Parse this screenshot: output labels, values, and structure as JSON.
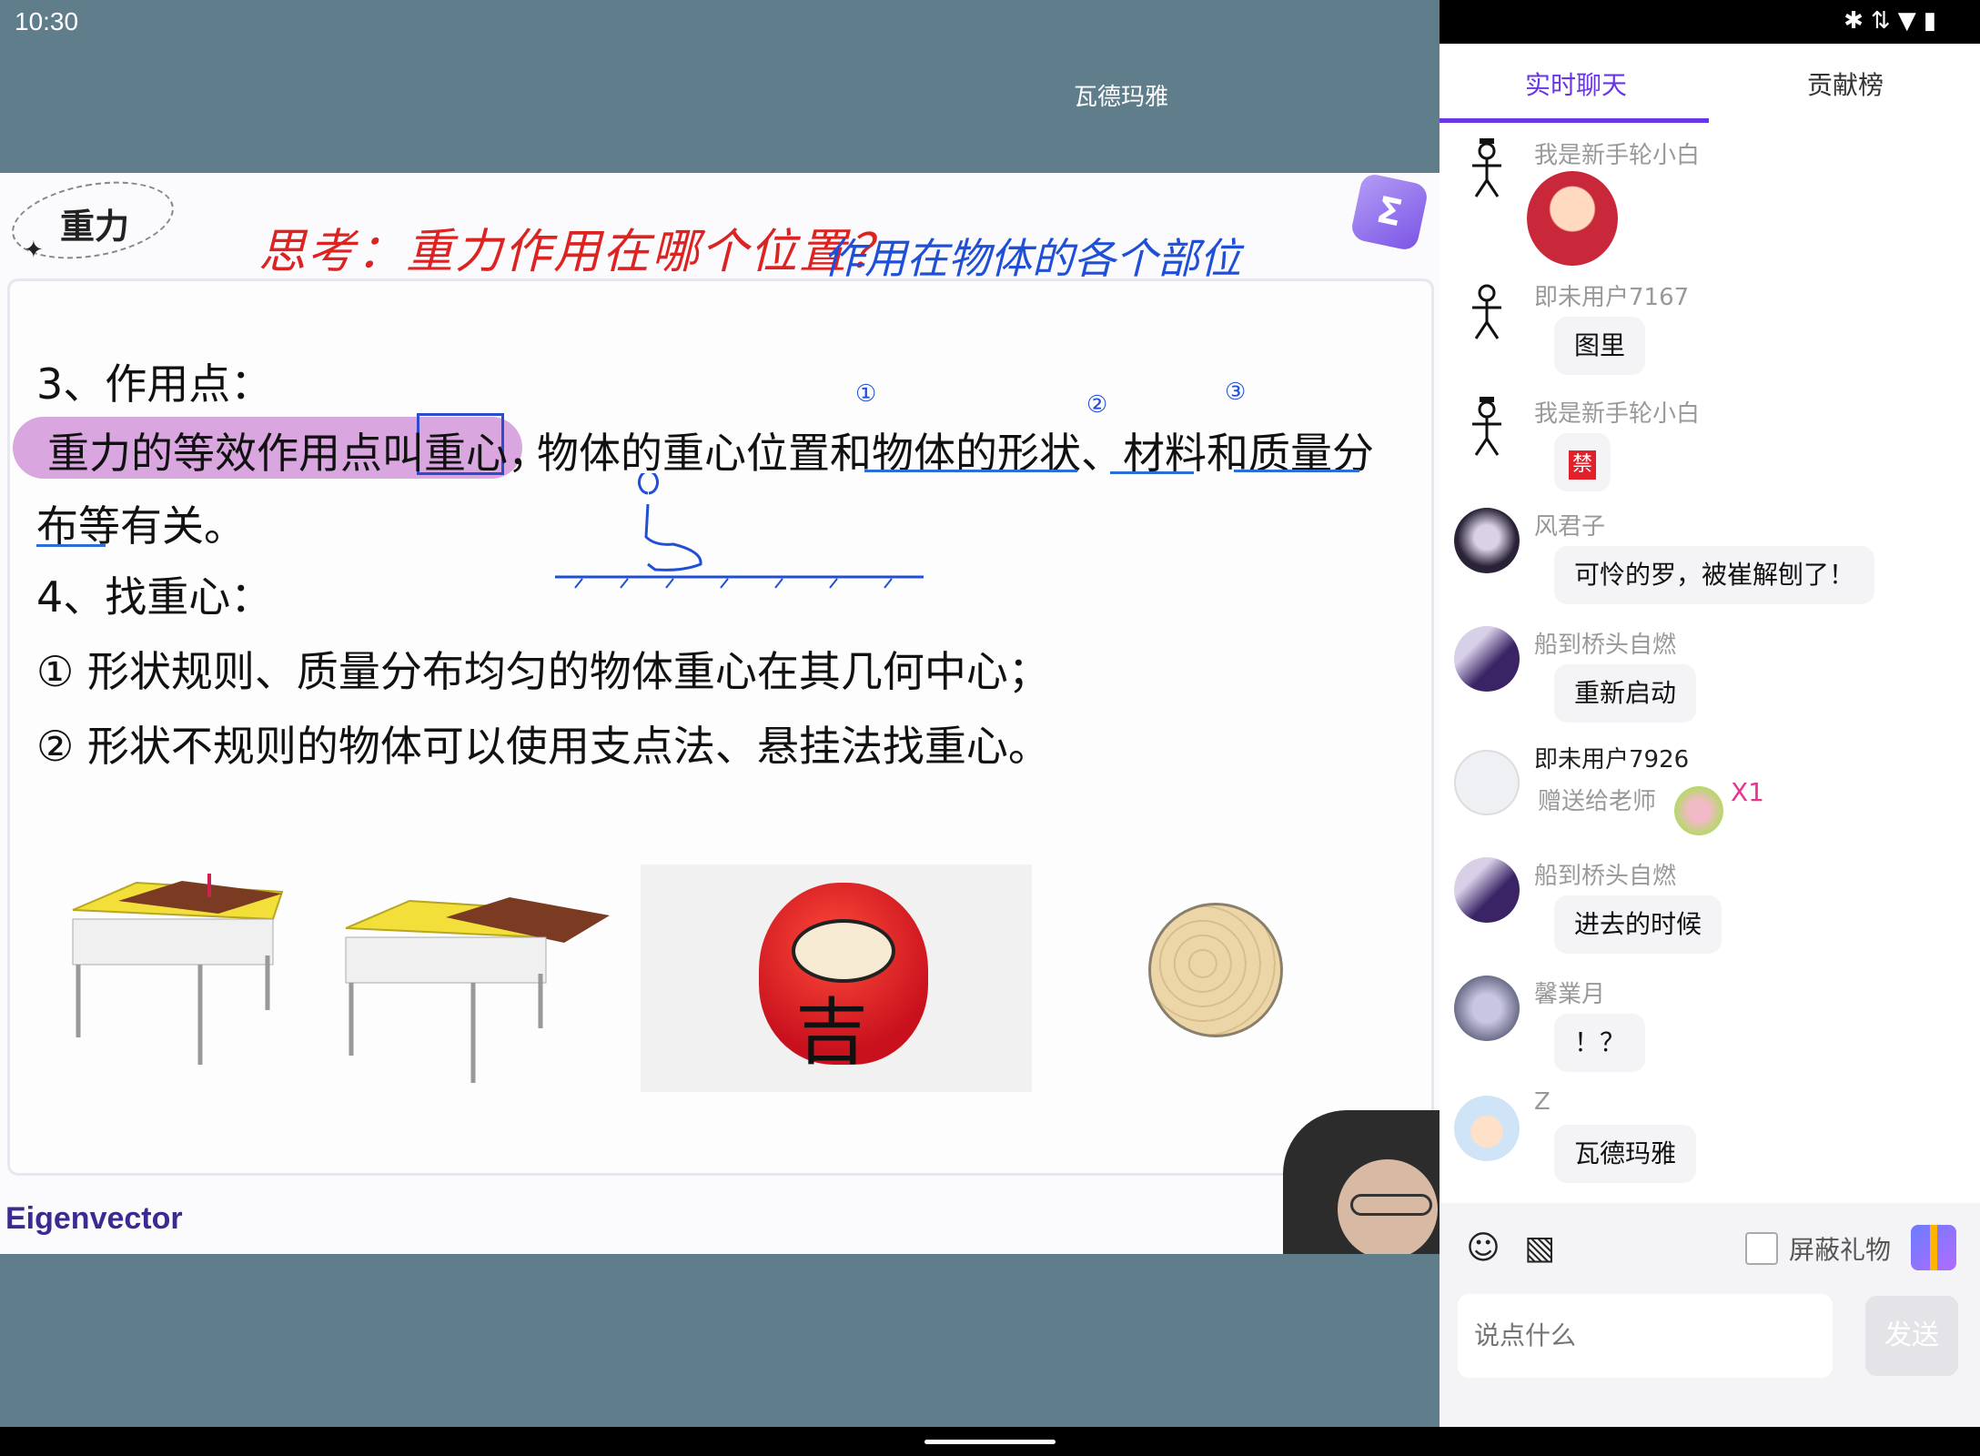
{
  "status_bar": {
    "time": "10:30",
    "icons": [
      "bluetooth-icon",
      "signal-icon",
      "wifi-icon",
      "battery-icon"
    ]
  },
  "room": {
    "title": "瓦德玛雅"
  },
  "slide": {
    "tag": "重力",
    "handwriting_red": "思考：重力作用在哪个位置？",
    "handwriting_blue": "作用在物体的各个部位",
    "point3_title": "3、作用点：",
    "point3_line1_highlight": "重力的等效作用点叫重心，",
    "point3_line1_rest": "物体的重心位置和物体的形状、材料和质量分",
    "point3_line2": "布等有关。",
    "point4_title": "4、找重心：",
    "point4_item1": "① 形状规则、质量分布均匀的物体重心在其几何中心；",
    "point4_item2": "② 形状不规则的物体可以使用支点法、悬挂法找重心。",
    "daruma_char": "吉",
    "annotations": [
      "①",
      "②",
      "③"
    ],
    "logo_text": "Eigenvector"
  },
  "chat": {
    "tabs": [
      {
        "label": "实时聊天",
        "active": true
      },
      {
        "label": "贡献榜",
        "active": false
      }
    ],
    "messages": [
      {
        "nick": "我是新手轮小白",
        "avatar": "stick-figure",
        "content_type": "sticker"
      },
      {
        "nick": "即未用户7167",
        "avatar": "stick-figure",
        "text": "图里"
      },
      {
        "nick": "我是新手轮小白",
        "avatar": "stick-figure",
        "content_type": "emoji",
        "emoji": "禁"
      },
      {
        "nick": "风君子",
        "avatar": "anime",
        "text": "可怜的罗，被崔解刨了！"
      },
      {
        "nick": "船到桥头自燃",
        "avatar": "purple",
        "text": "重新启动"
      },
      {
        "nick": "即未用户7926",
        "avatar": "ghost",
        "gift_text": "赠送给老师",
        "gift_count": "X1"
      },
      {
        "nick": "船到桥头自燃",
        "avatar": "purple",
        "text": "进去的时候"
      },
      {
        "nick": "馨業月",
        "avatar": "anime",
        "text": "！？"
      },
      {
        "nick": "Z",
        "avatar": "boy",
        "text": "瓦德玛雅"
      }
    ],
    "input": {
      "block_gifts_label": "屏蔽礼物",
      "block_gifts_checked": false,
      "placeholder": "说点什么",
      "send_label": "发送"
    }
  }
}
